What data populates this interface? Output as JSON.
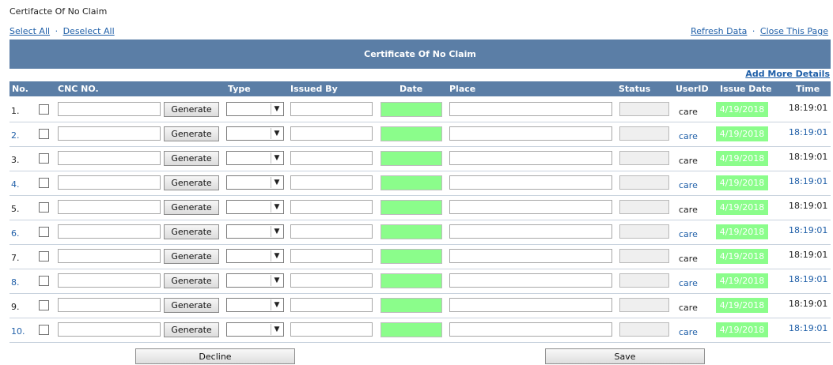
{
  "page_title": "Certifacte Of No Claim",
  "links": {
    "select_all": "Select All",
    "deselect_all": "Deselect All",
    "refresh": "Refresh Data",
    "close": "Close This Page",
    "separator": "·"
  },
  "banner": "Certificate Of No Claim",
  "add_more": "Add More Details",
  "columns": {
    "no": "No.",
    "cnc": "CNC NO.",
    "type": "Type",
    "issued_by": "Issued By",
    "date": "Date",
    "place": "Place",
    "status": "Status",
    "userid": "UserID",
    "issue_date": "Issue Date",
    "time": "Time"
  },
  "generate_label": "Generate",
  "rows": [
    {
      "no": "1.",
      "userid": "care",
      "issue_date": "4/19/2018",
      "time": "18:19:01"
    },
    {
      "no": "2.",
      "userid": "care",
      "issue_date": "4/19/2018",
      "time": "18:19:01"
    },
    {
      "no": "3.",
      "userid": "care",
      "issue_date": "4/19/2018",
      "time": "18:19:01"
    },
    {
      "no": "4.",
      "userid": "care",
      "issue_date": "4/19/2018",
      "time": "18:19:01"
    },
    {
      "no": "5.",
      "userid": "care",
      "issue_date": "4/19/2018",
      "time": "18:19:01"
    },
    {
      "no": "6.",
      "userid": "care",
      "issue_date": "4/19/2018",
      "time": "18:19:01"
    },
    {
      "no": "7.",
      "userid": "care",
      "issue_date": "4/19/2018",
      "time": "18:19:01"
    },
    {
      "no": "8.",
      "userid": "care",
      "issue_date": "4/19/2018",
      "time": "18:19:01"
    },
    {
      "no": "9.",
      "userid": "care",
      "issue_date": "4/19/2018",
      "time": "18:19:01"
    },
    {
      "no": "10.",
      "userid": "care",
      "issue_date": "4/19/2018",
      "time": "18:19:01"
    }
  ],
  "buttons": {
    "decline": "Decline",
    "save": "Save"
  },
  "colors": {
    "header_bg": "#5b7ea6",
    "date_green": "#8bfd8b",
    "link_blue": "#1f5fa8"
  },
  "icons": {
    "select_arrow": "chevron-down-icon"
  }
}
